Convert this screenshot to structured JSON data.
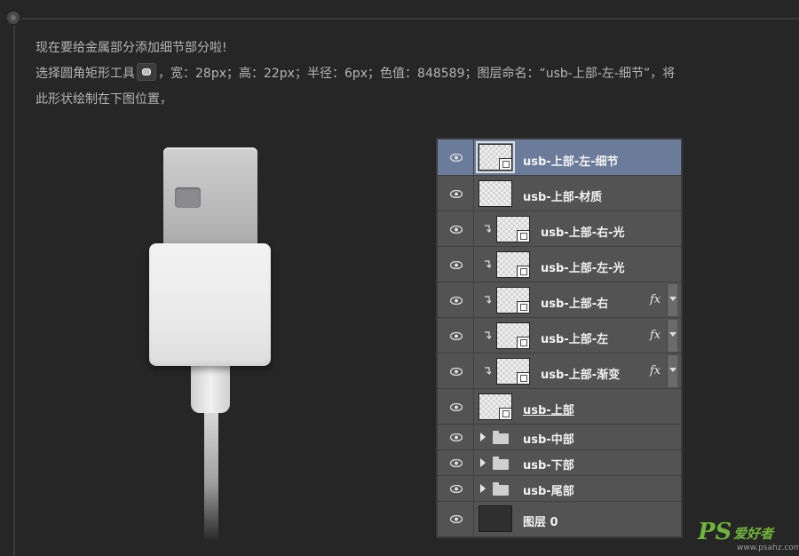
{
  "instructions": {
    "line1": "现在要给金属部分添加细节部分啦!",
    "line2_prefix": "选择圆角矩形工具",
    "line2_suffix": "，宽：28px；高：22px；半径：6px；色值：848589；图层命名：“usb-上部-左-细节”，将",
    "line3": "此形状绘制在下图位置，"
  },
  "layers_panel": {
    "layers": [
      {
        "name": "usb-上部-左-细节",
        "type": "shape",
        "selected": true,
        "clipped": false,
        "fx": false
      },
      {
        "name": "usb-上部-材质",
        "type": "shape",
        "selected": false,
        "clipped": false,
        "fx": false
      },
      {
        "name": "usb-上部-右-光",
        "type": "shape",
        "selected": false,
        "clipped": true,
        "fx": false
      },
      {
        "name": "usb-上部-左-光",
        "type": "shape",
        "selected": false,
        "clipped": true,
        "fx": false
      },
      {
        "name": "usb-上部-右",
        "type": "shape",
        "selected": false,
        "clipped": true,
        "fx": true
      },
      {
        "name": "usb-上部-左",
        "type": "shape",
        "selected": false,
        "clipped": true,
        "fx": true
      },
      {
        "name": "usb-上部-渐变",
        "type": "shape",
        "selected": false,
        "clipped": true,
        "fx": true
      },
      {
        "name": "usb-上部",
        "type": "shape",
        "selected": false,
        "clipped": false,
        "fx": false,
        "underline": true
      },
      {
        "name": "usb-中部",
        "type": "group"
      },
      {
        "name": "usb-下部",
        "type": "group"
      },
      {
        "name": "usb-尾部",
        "type": "group"
      },
      {
        "name": "图层 0",
        "type": "fill"
      }
    ],
    "fx_label": "fx"
  },
  "colors": {
    "background": "#262626",
    "panel": "#535353",
    "selected_row": "#6a7c9a",
    "detail_fill": "#848589"
  },
  "watermark": {
    "brand": "PS",
    "cn": "爱好者",
    "url": "www.psahz.com"
  }
}
